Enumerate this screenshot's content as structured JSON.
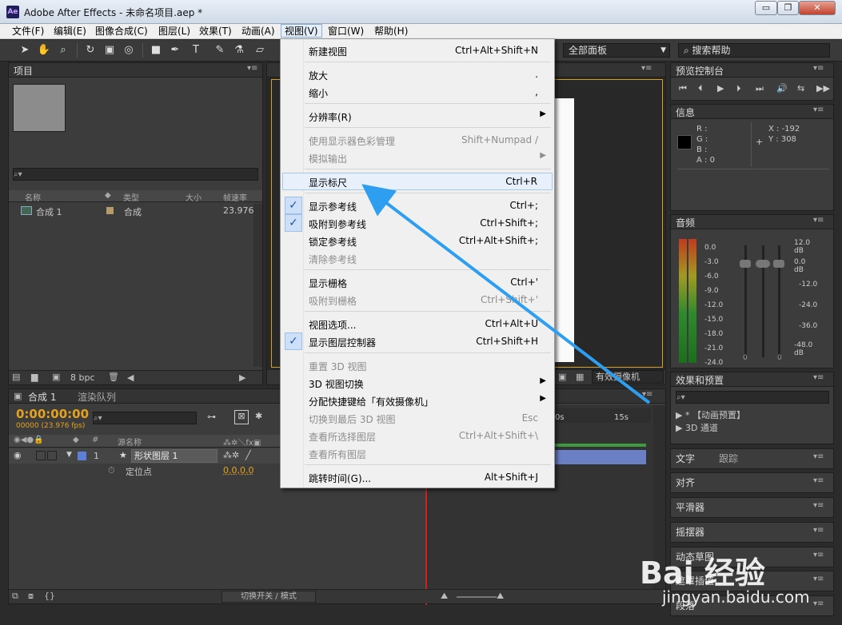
{
  "window": {
    "title": "Adobe After Effects - 未命名项目.aep *",
    "app_icon": "Ae",
    "minimize": "▭",
    "restore": "❐",
    "close": "✕"
  },
  "menubar": [
    "文件(F)",
    "编辑(E)",
    "图像合成(C)",
    "图层(L)",
    "效果(T)",
    "动画(A)",
    "视图(V)",
    "窗口(W)",
    "帮助(H)"
  ],
  "toolbar": {
    "workspace": "全部面板",
    "search_help": "搜索帮助"
  },
  "project_panel": {
    "tab": "项目",
    "columns": [
      "名称",
      "类型",
      "大小",
      "帧速率"
    ],
    "items": [
      {
        "name": "合成 1",
        "type": "合成",
        "fps": "23.976"
      }
    ],
    "bpc": "8 bpc"
  },
  "view_menu": {
    "items": [
      {
        "label": "新建视图",
        "shortcut": "Ctrl+Alt+Shift+N"
      },
      {
        "label": "放大",
        "shortcut": "."
      },
      {
        "label": "缩小",
        "shortcut": ","
      },
      {
        "label": "分辨率(R)",
        "shortcut": ""
      },
      {
        "label": "使用显示器色彩管理",
        "shortcut": "Shift+Numpad /"
      },
      {
        "label": "模拟输出",
        "shortcut": ""
      },
      {
        "label": "显示标尺",
        "shortcut": "Ctrl+R"
      },
      {
        "label": "显示参考线",
        "shortcut": "Ctrl+;"
      },
      {
        "label": "吸附到参考线",
        "shortcut": "Ctrl+Shift+;"
      },
      {
        "label": "锁定参考线",
        "shortcut": "Ctrl+Alt+Shift+;"
      },
      {
        "label": "清除参考线",
        "shortcut": ""
      },
      {
        "label": "显示栅格",
        "shortcut": "Ctrl+'"
      },
      {
        "label": "吸附到栅格",
        "shortcut": "Ctrl+Shift+'"
      },
      {
        "label": "视图选项...",
        "shortcut": "Ctrl+Alt+U"
      },
      {
        "label": "显示图层控制器",
        "shortcut": "Ctrl+Shift+H"
      },
      {
        "label": "重置 3D 视图",
        "shortcut": ""
      },
      {
        "label": "3D 视图切换",
        "shortcut": ""
      },
      {
        "label": "分配快捷键给「有效摄像机」",
        "shortcut": ""
      },
      {
        "label": "切换到最后 3D 视图",
        "shortcut": "Esc"
      },
      {
        "label": "查看所选择图层",
        "shortcut": "Ctrl+Alt+Shift+\\"
      },
      {
        "label": "查看所有图层",
        "shortcut": ""
      },
      {
        "label": "跳转时间(G)...",
        "shortcut": "Alt+Shift+J"
      }
    ],
    "check": "✓",
    "submenu_arrow": "▶"
  },
  "viewer": {
    "camera": "有效摄像机"
  },
  "timeline": {
    "tabs": [
      "合成 1",
      "渲染队列"
    ],
    "timecode": "0:00:00:00",
    "frame_info": "00000 (23.976 fps)",
    "col_hash": "#",
    "col_source": "源名称",
    "layer_index": "1",
    "layer_name": "形状图层 1",
    "anchor_label": "定位点",
    "anchor_value": "0.0,0.0",
    "ruler_marks": [
      "0s",
      "15s"
    ],
    "footer": "切换开关 / 模式"
  },
  "preview_panel": {
    "tab": "预览控制台"
  },
  "info_panel": {
    "tab": "信息",
    "channels": [
      "R :",
      "G :",
      "B :",
      "A : 0"
    ],
    "x": "X : -192",
    "y": "Y : 308"
  },
  "audio_panel": {
    "tab": "音频",
    "left_scale": [
      "0.0",
      "-3.0",
      "-6.0",
      "-9.0",
      "-12.0",
      "-15.0",
      "-18.0",
      "-21.0",
      "-24.0"
    ],
    "right_scale": [
      "12.0 dB",
      "0.0 dB",
      "-12.0",
      "-24.0",
      "-36.0",
      "-48.0 dB"
    ],
    "slider_zero": "0"
  },
  "effects_panel": {
    "tab": "效果和预置",
    "items": [
      "* 【动画预置】",
      "3D 通道"
    ]
  },
  "side_panels": [
    "文字",
    "跟踪",
    "对齐",
    "平滑器",
    "摇摆器",
    "动态草图",
    "遮罩插值",
    "段落"
  ],
  "watermark": {
    "brand": "Bai 经验",
    "url": "jingyan.baidu.com"
  }
}
